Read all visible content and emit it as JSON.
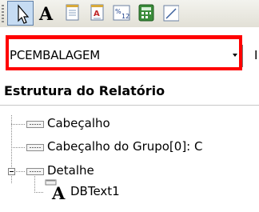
{
  "toolbar": {
    "buttons": [
      {
        "name": "select-pointer-icon",
        "pressed": true
      },
      {
        "name": "text-label-icon",
        "letter": "A"
      },
      {
        "name": "memo-icon"
      },
      {
        "name": "rich-text-icon"
      },
      {
        "name": "calc-icon"
      },
      {
        "name": "calculator-icon"
      },
      {
        "name": "line-icon"
      }
    ]
  },
  "data_pipeline": {
    "selected": "PCEMBALAGEM",
    "next_field_partial": "I"
  },
  "report_tree": {
    "title": "Estrutura do Relatório",
    "nodes": [
      {
        "label": "Cabeçalho",
        "icon": "band-icon"
      },
      {
        "label": "Cabeçalho do Grupo[0]: C",
        "icon": "band-icon"
      },
      {
        "label": "Detalhe",
        "icon": "band-icon",
        "expanded": true
      },
      {
        "label": "DBText1",
        "icon": "dbtext-icon"
      }
    ]
  },
  "colors": {
    "highlight_frame": "#ff0000",
    "toolbar_bg": "#e8e6dc",
    "pressed_bg": "#c6dcf3"
  }
}
